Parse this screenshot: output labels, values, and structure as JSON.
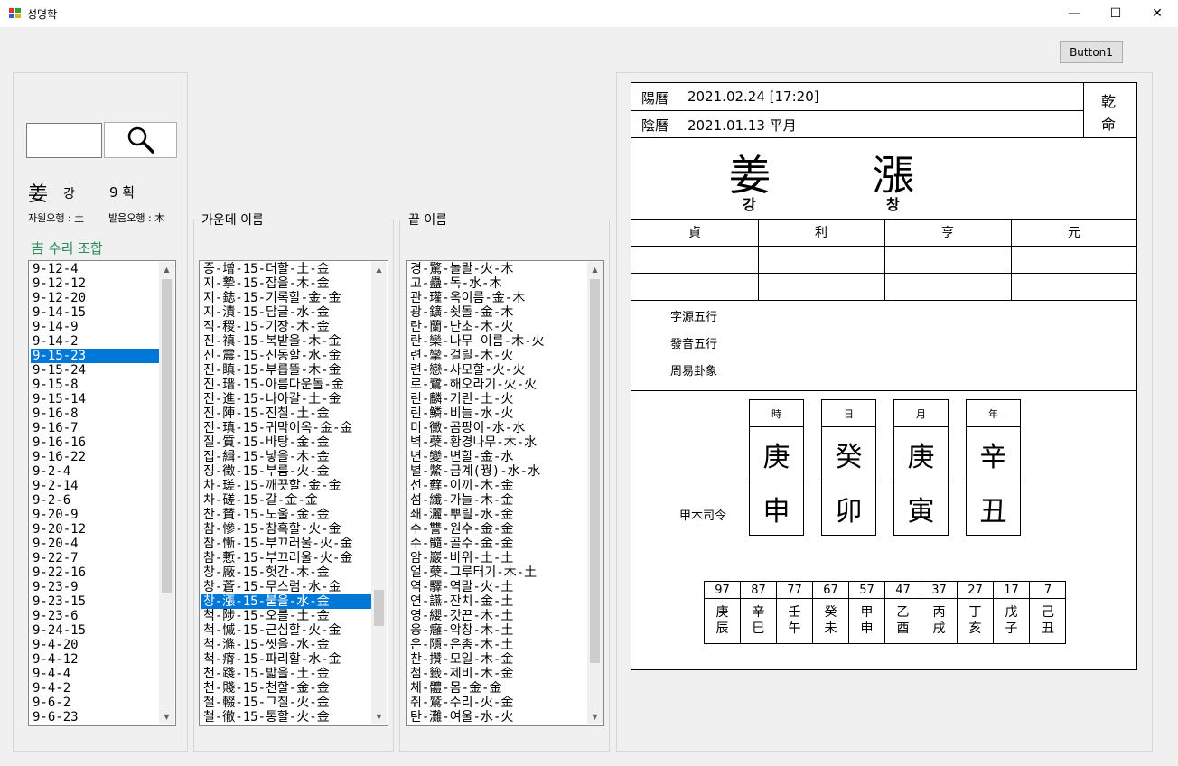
{
  "window": {
    "title": "성명학",
    "minimize": "—",
    "maximize": "☐",
    "close": "✕"
  },
  "button1": "Button1",
  "left": {
    "surname_hanja": "姜",
    "surname_hangul": "강",
    "strokes": "9 획",
    "jawon_ohaeng": "자원오행 : 土",
    "balum_ohaeng": "발음오행 : 木",
    "combo_title": "吉 수리 조합",
    "combos": [
      "9-12-4",
      "9-12-12",
      "9-12-20",
      "9-14-15",
      "9-14-9",
      "9-14-2",
      "9-15-23",
      "9-15-24",
      "9-15-8",
      "9-15-14",
      "9-16-8",
      "9-16-7",
      "9-16-16",
      "9-16-22",
      "9-2-4",
      "9-2-14",
      "9-2-6",
      "9-20-9",
      "9-20-12",
      "9-20-4",
      "9-22-7",
      "9-22-16",
      "9-23-9",
      "9-23-15",
      "9-23-6",
      "9-24-15",
      "9-4-20",
      "9-4-12",
      "9-4-4",
      "9-4-2",
      "9-6-2",
      "9-6-23"
    ],
    "selected_index": 6
  },
  "middle": {
    "title": "가운데 이름",
    "items": [
      "증-增-15-더할-土-金",
      "지-摯-15-잡을-木-金",
      "지-鋕-15-기록할-金-金",
      "지-漬-15-담글-水-金",
      "직-稷-15-기장-木-金",
      "진-禛-15-복받을-木-金",
      "진-震-15-진동할-水-金",
      "진-瞋-15-부릅뜰-木-金",
      "진-瑨-15-아름다운돌-金",
      "진-進-15-나아갈-土-金",
      "진-陣-15-진칠-土-金",
      "진-瑱-15-귀막이옥-金-金",
      "질-質-15-바탕-金-金",
      "집-緝-15-낳을-木-金",
      "징-徵-15-부름-火-金",
      "차-瑳-15-깨끗할-金-金",
      "차-磋-15-갈-金-金",
      "찬-賛-15-도울-金-金",
      "참-慘-15-참혹할-火-金",
      "참-慚-15-부끄러울-火-金",
      "참-慙-15-부끄러울-火-金",
      "창-廠-15-헛간-木-金",
      "창-蒼-15-무스럼-水-金",
      "창-漲-15-불을-水-金",
      "척-陟-15-오를-土-金",
      "척-慽-15-근심할-火-金",
      "척-滌-15-씻을-水-金",
      "척-瘠-15-파리할-水-金",
      "천-踐-15-밟을-土-金",
      "천-賤-15-천할-金-金",
      "철-輟-15-그칠-火-金",
      "철-徹-15-통할-火-金"
    ],
    "selected_index": 23
  },
  "last": {
    "title": "끝 이름",
    "items": [
      "경-驚-놀랄-火-木",
      "고-蠱-독-水-木",
      "관-瓘-옥이름-金-木",
      "광-鑛-쇳돌-金-木",
      "란-蘭-난초-木-火",
      "란-欒-나무 이름-木-火",
      "련-攣-걸릴-木-火",
      "련-戀-사모할-火-火",
      "로-鷺-해오라기-火-火",
      "린-麟-기린-土-火",
      "린-鱗-비늘-水-火",
      "미-黴-곰팡이-水-水",
      "벽-蘗-황경나무-木-水",
      "변-變-변할-金-水",
      "별-鱉-금계(꿩)-水-水",
      "선-蘚-이끼-木-金",
      "섬-纖-가늘-木-金",
      "쇄-灑-뿌릴-水-金",
      "수-讐-원수-金-金",
      "수-髓-골수-金-金",
      "암-巖-바위-土-土",
      "얼-蘖-그루터기-木-土",
      "역-驛-역말-火-土",
      "연-讌-잔치-金-土",
      "영-纓-갓끈-木-土",
      "옹-癰-악창-木-土",
      "은-隱-은총-木-土",
      "찬-攢-모일-木-金",
      "첨-籤-제비-木-金",
      "체-體-몸-金-金",
      "취-鷲-수리-火-金",
      "탄-灘-여울-水-火"
    ]
  },
  "chart": {
    "solar_label": "陽曆",
    "solar_date": "2021.02.24 [17:20]",
    "lunar_label": "陰曆",
    "lunar_date": "2021.01.13 平月",
    "gender_1": "乾",
    "gender_2": "命",
    "name_hanja_1": "姜",
    "name_hanja_2": "漲",
    "name_hangul_1": "강",
    "name_hangul_2": "창",
    "yuan_headers": [
      "貞",
      "利",
      "亨",
      "元"
    ],
    "ohaeng_labels": [
      "字源五行",
      "發音五行",
      "周易卦象"
    ],
    "saryeong": "甲木司令",
    "pillars": [
      {
        "label": "時",
        "stem": "庚",
        "branch": "申"
      },
      {
        "label": "日",
        "stem": "癸",
        "branch": "卯"
      },
      {
        "label": "月",
        "stem": "庚",
        "branch": "寅"
      },
      {
        "label": "年",
        "stem": "辛",
        "branch": "丑"
      }
    ],
    "daeun": [
      {
        "age": "97",
        "stem": "庚",
        "branch": "辰"
      },
      {
        "age": "87",
        "stem": "辛",
        "branch": "巳"
      },
      {
        "age": "77",
        "stem": "壬",
        "branch": "午"
      },
      {
        "age": "67",
        "stem": "癸",
        "branch": "未"
      },
      {
        "age": "57",
        "stem": "甲",
        "branch": "申"
      },
      {
        "age": "47",
        "stem": "乙",
        "branch": "酉"
      },
      {
        "age": "37",
        "stem": "丙",
        "branch": "戌"
      },
      {
        "age": "27",
        "stem": "丁",
        "branch": "亥"
      },
      {
        "age": "17",
        "stem": "戊",
        "branch": "子"
      },
      {
        "age": "7",
        "stem": "己",
        "branch": "丑"
      }
    ]
  }
}
